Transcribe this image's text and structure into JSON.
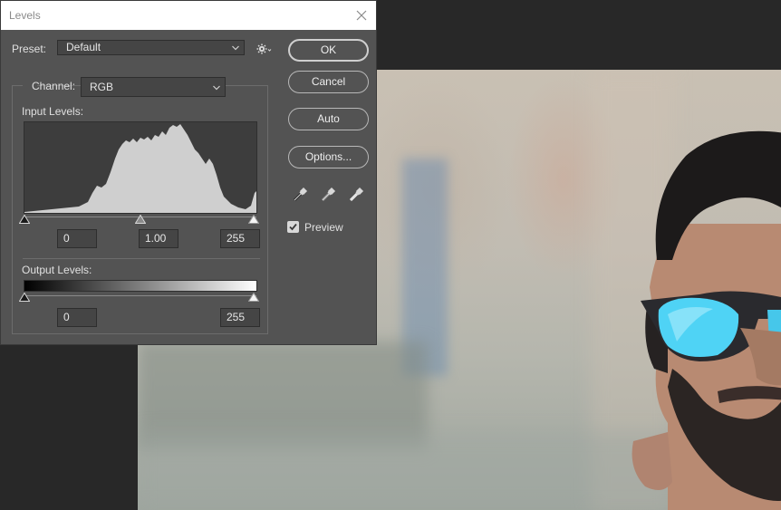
{
  "dialog": {
    "title": "Levels"
  },
  "preset": {
    "label": "Preset:",
    "value": "Default"
  },
  "channel": {
    "label": "Channel:",
    "value": "RGB"
  },
  "input_levels": {
    "label": "Input Levels:",
    "black": "0",
    "gamma": "1.00",
    "white": "255"
  },
  "output_levels": {
    "label": "Output Levels:",
    "black": "0",
    "white": "255"
  },
  "buttons": {
    "ok": "OK",
    "cancel": "Cancel",
    "auto": "Auto",
    "options": "Options..."
  },
  "preview": {
    "label": "Preview",
    "checked": true
  },
  "icons": [
    "close-icon",
    "chevron-down-icon",
    "gear-icon",
    "black-eyedropper-icon",
    "gray-eyedropper-icon",
    "white-eyedropper-icon",
    "checkmark-icon"
  ],
  "colors": {
    "dialog_bg": "#535353",
    "histogram_fill": "#cfcfcf",
    "histogram_bg": "#3d3d3d",
    "sunglasses_lens": "#4fd3f5"
  }
}
